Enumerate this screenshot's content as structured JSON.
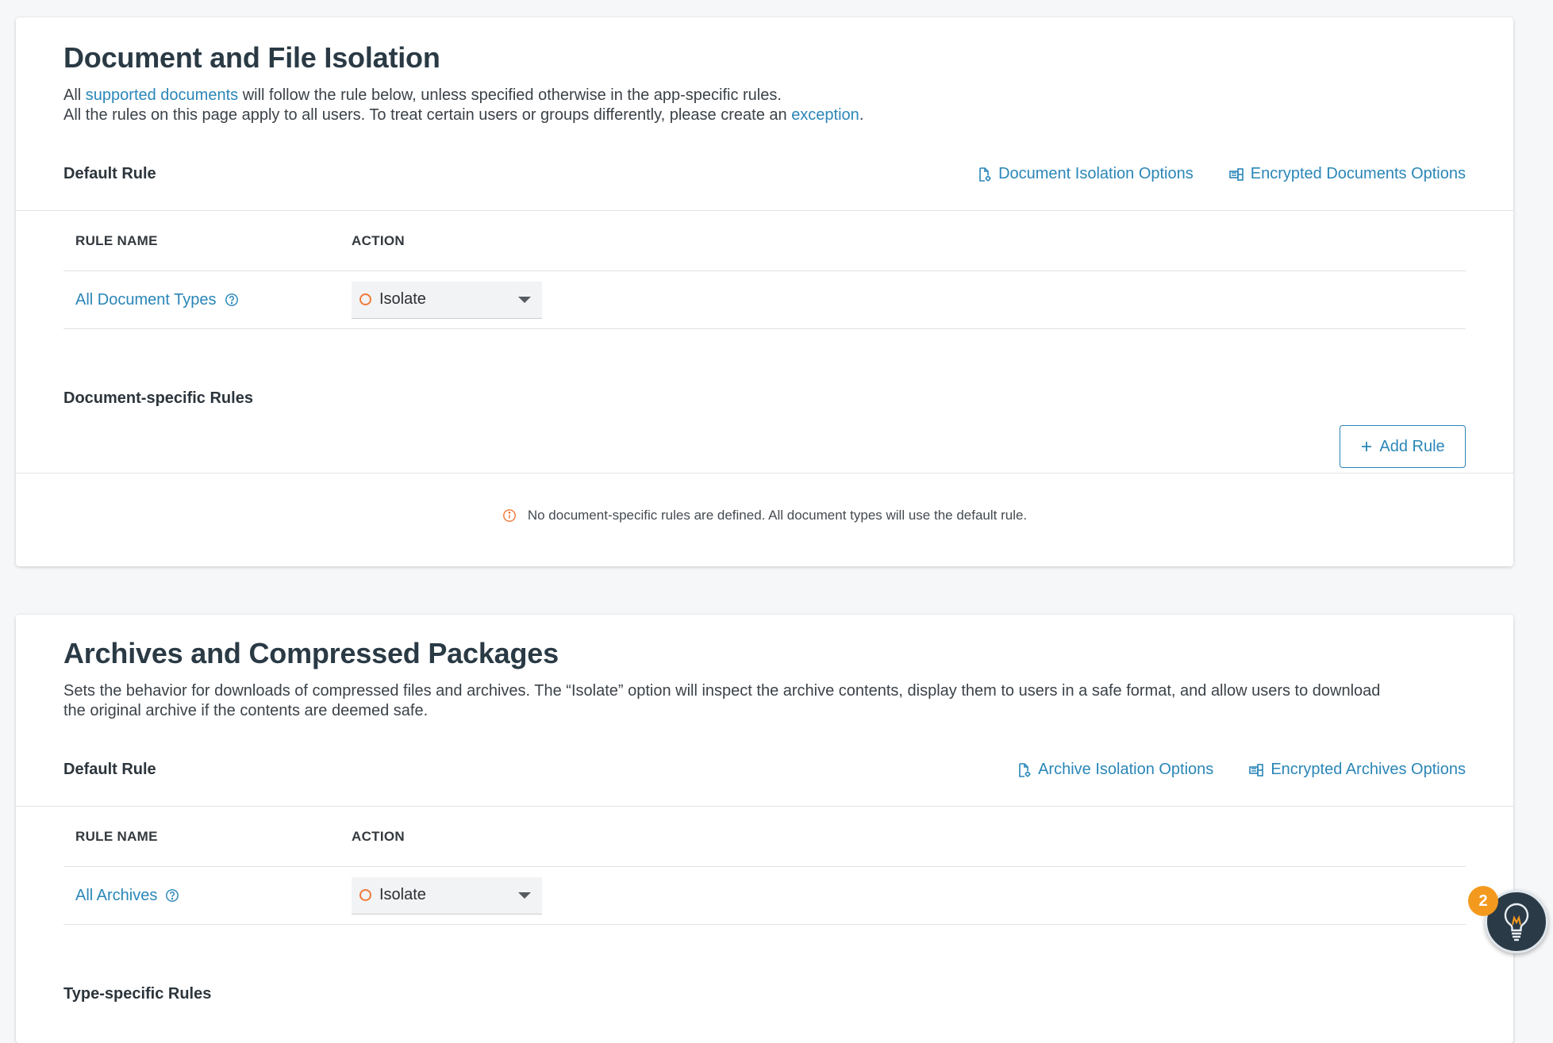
{
  "documents": {
    "title": "Document and File Isolation",
    "desc_line1_prefix": "All ",
    "desc_line1_link": "supported documents",
    "desc_line1_suffix": " will follow the rule below, unless specified otherwise in the app-specific rules.",
    "desc_line2_prefix": "All the rules on this page apply to all users. To treat certain users or groups differently, please create an ",
    "desc_line2_link": "exception",
    "desc_line2_suffix": ".",
    "default_rule_label": "Default Rule",
    "option_link_1": "Document Isolation Options",
    "option_link_2": "Encrypted Documents Options",
    "col_rule_name": "RULE NAME",
    "col_action": "ACTION",
    "rule": {
      "name": "All Document Types",
      "action": "Isolate"
    },
    "specific_title": "Document-specific Rules",
    "add_rule_label": "Add Rule",
    "empty_message": "No document-specific rules are defined. All document types will use the default rule."
  },
  "archives": {
    "title": "Archives and Compressed Packages",
    "desc_line1": "Sets the behavior for downloads of compressed files and archives. The “Isolate” option will inspect the archive contents, display them to users in a safe format, and allow users to download",
    "desc_line2": "the original archive if the contents are deemed safe.",
    "default_rule_label": "Default Rule",
    "option_link_1": "Archive Isolation Options",
    "option_link_2": "Encrypted Archives Options",
    "col_rule_name": "RULE NAME",
    "col_action": "ACTION",
    "rule": {
      "name": "All Archives",
      "action": "Isolate"
    },
    "specific_title": "Type-specific Rules"
  },
  "assistant": {
    "badge_count": "2",
    "icon": "lightbulb-icon"
  },
  "colors": {
    "accent": "#2a86b8",
    "warning": "#f07a3a",
    "badge": "#f39a1e",
    "fab_bg": "#2b3a47"
  }
}
